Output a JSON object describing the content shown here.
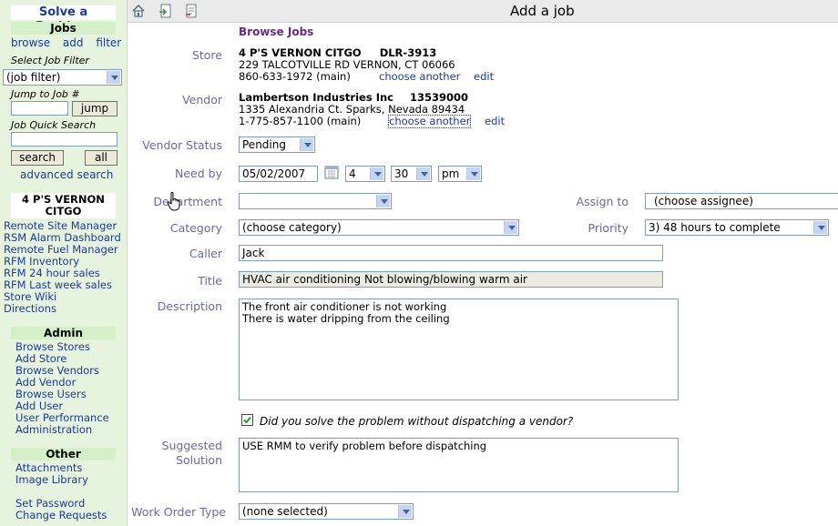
{
  "sidebar": {
    "title": "Solve a Problem",
    "jobs_header": "Jobs",
    "jobs_links": [
      "browse",
      "add",
      "filter"
    ],
    "select_filter_label": "Select Job Filter",
    "job_filter_value": "(job filter)",
    "jump_label": "Jump to Job #",
    "jump_button": "jump",
    "quick_search_label": "Job Quick Search",
    "search_button": "search",
    "all_button": "all",
    "advanced_search": "advanced search",
    "store_header": "4 P'S VERNON CITGO",
    "store_links": [
      "Remote Site Manager",
      "RSM Alarm Dashboard",
      "Remote Fuel Manager",
      "RFM Inventory",
      "RFM 24 hour sales",
      "RFM Last week sales",
      "Store Wiki",
      "Directions"
    ],
    "admin_header": "Admin",
    "admin_links": [
      "Browse Stores",
      "Add Store",
      "Browse Vendors",
      "Add Vendor",
      "Browse Users",
      "Add User",
      "User Performance",
      "Administration"
    ],
    "other_header": "Other",
    "other_links": [
      "Attachments",
      "Image Library"
    ],
    "account_links": [
      "Set Password",
      "Change Requests"
    ]
  },
  "topbar": {
    "title": "Add a job",
    "icons": [
      "home-icon",
      "export-icon",
      "print-icon"
    ]
  },
  "form": {
    "browse_jobs": "Browse Jobs",
    "store": {
      "label": "Store",
      "name": "4 P'S VERNON CITGO",
      "code": "DLR-3913",
      "address": "229 TALCOTVILLE RD VERNON, CT  06066",
      "phone": "860-633-1972 (main)",
      "choose_another": "choose another",
      "edit": "edit"
    },
    "vendor": {
      "label": "Vendor",
      "name": "Lambertson Industries Inc",
      "code": "13539000",
      "address": "1335 Alexandria Ct. Sparks, Nevada  89434",
      "phone": "1-775-857-1100 (main)",
      "choose_another": "choose another",
      "edit": "edit"
    },
    "vendor_status": {
      "label": "Vendor Status",
      "value": "Pending"
    },
    "need_by": {
      "label": "Need by",
      "date": "05/02/2007",
      "hour": "4",
      "minute": "30",
      "ampm": "pm"
    },
    "department": {
      "label": "Department",
      "value": ""
    },
    "assign_to": {
      "label": "Assign to",
      "value": "(choose assignee)"
    },
    "category": {
      "label": "Category",
      "value": "(choose category)"
    },
    "priority": {
      "label": "Priority",
      "value": "3) 48 hours to complete"
    },
    "caller": {
      "label": "Caller",
      "value": "Jack"
    },
    "title": {
      "label": "Title",
      "value": "HVAC air conditioning Not blowing/blowing warm air"
    },
    "description": {
      "label": "Description",
      "line1": "The front air conditioner is not working",
      "line2": "There is water dripping from the ceiling"
    },
    "solved_checkbox": {
      "label": "Did you solve the problem without dispatching a vendor?",
      "checked": true
    },
    "suggested_solution": {
      "label_line1": "Suggested",
      "label_line2": "Solution",
      "value": "USE RMM to verify problem before dispatching"
    },
    "work_order_type": {
      "label": "Work Order Type",
      "value": "(none selected)"
    }
  }
}
